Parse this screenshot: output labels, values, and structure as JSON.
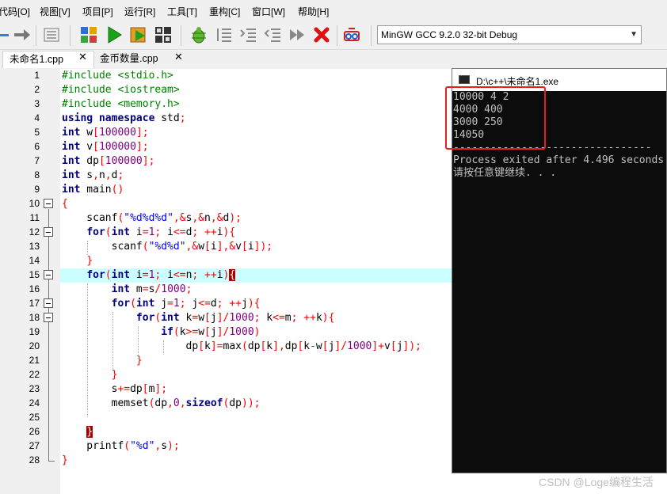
{
  "menu": [
    "代码[O]",
    "视图[V]",
    "项目[P]",
    "运行[R]",
    "工具[T]",
    "重构[C]",
    "窗口[W]",
    "帮助[H]"
  ],
  "toolbar": {
    "compiler": "MinGW GCC 9.2.0 32-bit Debug",
    "icons": [
      "arrow-left-icon",
      "arrow-right-icon",
      "indent-icon",
      "compile-icon",
      "run-icon",
      "compile-run-icon",
      "rebuild-icon",
      "debug-icon",
      "step-icon",
      "step-into-icon",
      "step-out-icon",
      "continue-icon",
      "stop-icon",
      "profile-icon"
    ]
  },
  "tabs": [
    {
      "label": "未命名1.cpp",
      "active": true
    },
    {
      "label": "金币数量.cpp",
      "active": false
    }
  ],
  "editor": {
    "line_numbers": [
      "1",
      "2",
      "3",
      "4",
      "5",
      "6",
      "7",
      "8",
      "9",
      "10",
      "11",
      "12",
      "13",
      "14",
      "15",
      "16",
      "17",
      "18",
      "19",
      "20",
      "21",
      "22",
      "23",
      "24",
      "25",
      "26",
      "27",
      "28"
    ],
    "current_line": "15"
  },
  "console": {
    "title": "D:\\c++\\未命名1.exe",
    "lines": [
      "10000 4 2",
      "4000 400",
      "3000 250",
      "14050",
      "--------------------------------",
      "Process exited after 4.496 seconds",
      "请按任意键继续. . ."
    ]
  },
  "watermark": "CSDN @Loge编程生活",
  "colors": {
    "keyword": "#000080",
    "number": "#800080",
    "operator": "#ff0000",
    "string": "#0000ff",
    "current_line": "#ccffff",
    "highlight_box": "#e51e1e"
  }
}
